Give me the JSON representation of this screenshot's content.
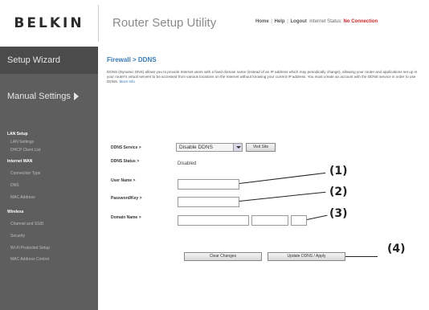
{
  "header": {
    "brand": "BELKIN",
    "app_title": "Router Setup Utility",
    "links": [
      "Home",
      "Help",
      "Logout"
    ],
    "internet_status_label": "Internet Status:",
    "internet_status_value": "No Connection"
  },
  "sidebar": {
    "setup_wizard": "Setup Wizard",
    "manual_settings": "Manual Settings",
    "sections": [
      {
        "title": "LAN Setup",
        "items": [
          "LAN Settings",
          "DHCP Client List"
        ]
      },
      {
        "title": "Internet WAN",
        "items": [
          "Connection Type",
          "DNS",
          "MAC Address"
        ]
      },
      {
        "title": "Wireless",
        "items": [
          "Channel and SSID",
          "Security",
          "Wi-Fi Protected Setup",
          "MAC Address Control"
        ]
      }
    ]
  },
  "main": {
    "breadcrumb": "Firewall > DDNS",
    "description": "DDNS (Dynamic DNS) allows you to provide Internet users with a fixed domain name (instead of an IP address which may periodically change), allowing your router and applications set up in your router's virtual servers to be accessed from various locations on the Internet without knowing your current IP address. You must create an account with the DDNS service in order to use DDNS.",
    "more_info": "More Info",
    "form": {
      "service_label": "DDNS Service >",
      "service_value": "Disable DDNS",
      "visit_site": "Visit Site",
      "status_label": "DDNS Status >",
      "status_value": "Disabled",
      "user_name_label": "User Name >",
      "user_name_value": "",
      "password_label": "Password/Key >",
      "password_value": "",
      "domain_label": "Domain Name >",
      "domain_parts": [
        "",
        "",
        ""
      ]
    },
    "buttons": {
      "clear": "Clear Changes",
      "update": "Update DDNS / Apply"
    }
  },
  "callouts": [
    "(1)",
    "(2)",
    "(3)",
    "(4)"
  ],
  "colors": {
    "sidebar_bg": "#5e5e5e",
    "accent_blue": "#3a7bb8",
    "status_red": "#cc2222"
  }
}
